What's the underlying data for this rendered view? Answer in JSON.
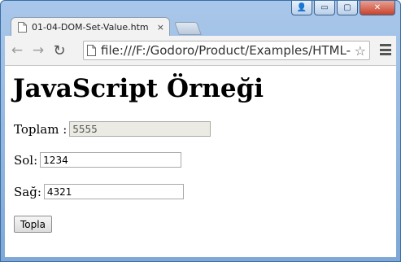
{
  "window": {
    "controls": {
      "user": "👤",
      "minimize": "▭",
      "maximize": "▢",
      "close": "✕"
    }
  },
  "tab": {
    "title": "01-04-DOM-Set-Value.htm",
    "close": "×"
  },
  "toolbar": {
    "back": "←",
    "forward": "→",
    "reload": "↻",
    "url": "file:///F:/Godoro/Product/Examples/HTML-",
    "star": "☆"
  },
  "page": {
    "heading": "JavaScript Örneği",
    "toplam_label": "Toplam :",
    "toplam_value": "5555",
    "sol_label": "Sol:",
    "sol_value": "1234",
    "sag_label": "Sağ:",
    "sag_value": "4321",
    "button_label": "Topla"
  }
}
